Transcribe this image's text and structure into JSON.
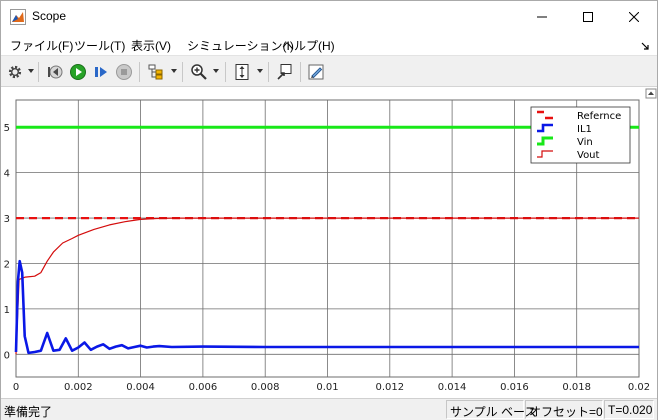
{
  "window": {
    "title": "Scope"
  },
  "menu": {
    "items": [
      "ファイル(F)",
      "ツール(T)",
      "表示(V)",
      "シミュレーション(I)",
      "ヘルプ(H)"
    ]
  },
  "status": {
    "message": "準備完了",
    "sample_base": "サンプル ベース",
    "offset": "オフセット=0",
    "time": "T=0.020"
  },
  "colors": {
    "reference": "#e81010",
    "il1": "#0a18e6",
    "vin": "#18e818",
    "vout": "#d40c0c",
    "plot_bg": "#ffffff",
    "grid": "#6e6e6e"
  },
  "chart_data": {
    "type": "line",
    "xlim": [
      0,
      0.02
    ],
    "ylim": [
      -0.5,
      5.6
    ],
    "xticks": [
      "0",
      "0.002",
      "0.004",
      "0.006",
      "0.008",
      "0.01",
      "0.012",
      "0.014",
      "0.016",
      "0.018",
      "0.02"
    ],
    "yticks": [
      "0",
      "1",
      "2",
      "3",
      "4",
      "5"
    ],
    "grid": true,
    "legend_position": "top-right",
    "series": [
      {
        "name": "Refernce",
        "style": "dashed",
        "points": [
          [
            0,
            3
          ],
          [
            0.02,
            3
          ]
        ]
      },
      {
        "name": "IL1",
        "style": "solid",
        "points": [
          [
            0,
            0.05
          ],
          [
            6e-05,
            1.6
          ],
          [
            0.00012,
            2.05
          ],
          [
            0.0002,
            1.8
          ],
          [
            0.00028,
            0.4
          ],
          [
            0.0004,
            0.03
          ],
          [
            0.0006,
            0.05
          ],
          [
            0.0008,
            0.08
          ],
          [
            0.001,
            0.47
          ],
          [
            0.0012,
            0.08
          ],
          [
            0.0014,
            0.1
          ],
          [
            0.0016,
            0.35
          ],
          [
            0.0018,
            0.08
          ],
          [
            0.002,
            0.15
          ],
          [
            0.0022,
            0.26
          ],
          [
            0.0024,
            0.1
          ],
          [
            0.0026,
            0.17
          ],
          [
            0.0028,
            0.22
          ],
          [
            0.003,
            0.12
          ],
          [
            0.0032,
            0.17
          ],
          [
            0.0034,
            0.2
          ],
          [
            0.0036,
            0.13
          ],
          [
            0.0038,
            0.16
          ],
          [
            0.004,
            0.19
          ],
          [
            0.0042,
            0.15
          ],
          [
            0.0044,
            0.17
          ],
          [
            0.0046,
            0.18
          ],
          [
            0.005,
            0.16
          ],
          [
            0.006,
            0.17
          ],
          [
            0.008,
            0.16
          ],
          [
            0.01,
            0.16
          ],
          [
            0.014,
            0.16
          ],
          [
            0.02,
            0.16
          ]
        ]
      },
      {
        "name": "Vin",
        "style": "solid",
        "points": [
          [
            0,
            5
          ],
          [
            0.02,
            5
          ]
        ]
      },
      {
        "name": "Vout",
        "style": "solid",
        "points": [
          [
            0,
            0
          ],
          [
            0.0001,
            1.65
          ],
          [
            0.0003,
            1.7
          ],
          [
            0.0006,
            1.72
          ],
          [
            0.0008,
            1.8
          ],
          [
            0.001,
            2.05
          ],
          [
            0.0012,
            2.25
          ],
          [
            0.0015,
            2.45
          ],
          [
            0.0018,
            2.55
          ],
          [
            0.002,
            2.62
          ],
          [
            0.0025,
            2.75
          ],
          [
            0.003,
            2.85
          ],
          [
            0.0035,
            2.92
          ],
          [
            0.004,
            2.97
          ],
          [
            0.0045,
            2.99
          ],
          [
            0.005,
            3.0
          ],
          [
            0.02,
            3.0
          ]
        ]
      }
    ]
  }
}
